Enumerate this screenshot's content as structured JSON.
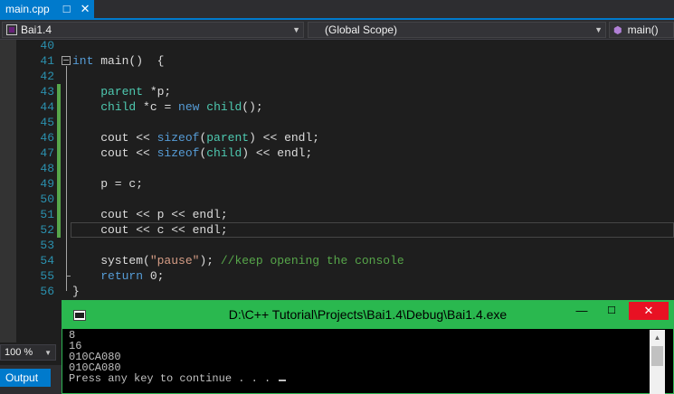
{
  "tab": {
    "title": "main.cpp",
    "pin_icon": "pin-icon",
    "close_icon": "close-icon"
  },
  "nav": {
    "project": "Bai1.4",
    "scope": "(Global Scope)",
    "member": "main()"
  },
  "editor": {
    "lines": [
      {
        "n": "40",
        "tokens": []
      },
      {
        "n": "41",
        "tokens": [
          {
            "t": "int",
            "c": "kw"
          },
          {
            "t": " main()  {",
            "c": ""
          }
        ]
      },
      {
        "n": "42",
        "tokens": []
      },
      {
        "n": "43",
        "tokens": [
          {
            "t": "    ",
            "c": ""
          },
          {
            "t": "parent",
            "c": "ty"
          },
          {
            "t": " *p;",
            "c": ""
          }
        ]
      },
      {
        "n": "44",
        "tokens": [
          {
            "t": "    ",
            "c": ""
          },
          {
            "t": "child",
            "c": "ty"
          },
          {
            "t": " *c = ",
            "c": ""
          },
          {
            "t": "new",
            "c": "kw"
          },
          {
            "t": " ",
            "c": ""
          },
          {
            "t": "child",
            "c": "ty"
          },
          {
            "t": "();",
            "c": ""
          }
        ]
      },
      {
        "n": "45",
        "tokens": []
      },
      {
        "n": "46",
        "tokens": [
          {
            "t": "    cout << ",
            "c": ""
          },
          {
            "t": "sizeof",
            "c": "kw"
          },
          {
            "t": "(",
            "c": ""
          },
          {
            "t": "parent",
            "c": "ty"
          },
          {
            "t": ") << endl;",
            "c": ""
          }
        ]
      },
      {
        "n": "47",
        "tokens": [
          {
            "t": "    cout << ",
            "c": ""
          },
          {
            "t": "sizeof",
            "c": "kw"
          },
          {
            "t": "(",
            "c": ""
          },
          {
            "t": "child",
            "c": "ty"
          },
          {
            "t": ") << endl;",
            "c": ""
          }
        ]
      },
      {
        "n": "48",
        "tokens": []
      },
      {
        "n": "49",
        "tokens": [
          {
            "t": "    p = c;",
            "c": ""
          }
        ]
      },
      {
        "n": "50",
        "tokens": []
      },
      {
        "n": "51",
        "tokens": [
          {
            "t": "    cout << p << endl;",
            "c": ""
          }
        ]
      },
      {
        "n": "52",
        "tokens": [
          {
            "t": "    cout << c << endl;",
            "c": ""
          }
        ]
      },
      {
        "n": "53",
        "tokens": []
      },
      {
        "n": "54",
        "tokens": [
          {
            "t": "    system(",
            "c": ""
          },
          {
            "t": "\"pause\"",
            "c": "str"
          },
          {
            "t": "); ",
            "c": ""
          },
          {
            "t": "//keep opening the console",
            "c": "cm"
          }
        ]
      },
      {
        "n": "55",
        "tokens": [
          {
            "t": "    ",
            "c": ""
          },
          {
            "t": "return",
            "c": "kw"
          },
          {
            "t": " 0;",
            "c": ""
          }
        ]
      },
      {
        "n": "56",
        "tokens": [
          {
            "t": "}",
            "c": ""
          }
        ]
      }
    ],
    "changed_lines": [
      "43",
      "44",
      "45",
      "46",
      "47",
      "48",
      "49",
      "50",
      "51",
      "52"
    ],
    "current_line": "52"
  },
  "zoom": {
    "level": "100 %"
  },
  "output_tab": {
    "label": "Output"
  },
  "console": {
    "title": "D:\\C++ Tutorial\\Projects\\Bai1.4\\Debug\\Bai1.4.exe",
    "output": [
      "8",
      "16",
      "010CA080",
      "010CA080",
      "Press any key to continue . . . "
    ],
    "min_label": "—",
    "max_label": "☐",
    "close_label": "✕"
  },
  "colors": {
    "keyword": "#569cd6",
    "type": "#4ec9b0",
    "string": "#d69d85",
    "comment": "#57a64a",
    "line_number": "#2b91af",
    "accent": "#007acc",
    "console_title_bg": "#2ab84f",
    "close_red": "#e81123"
  }
}
